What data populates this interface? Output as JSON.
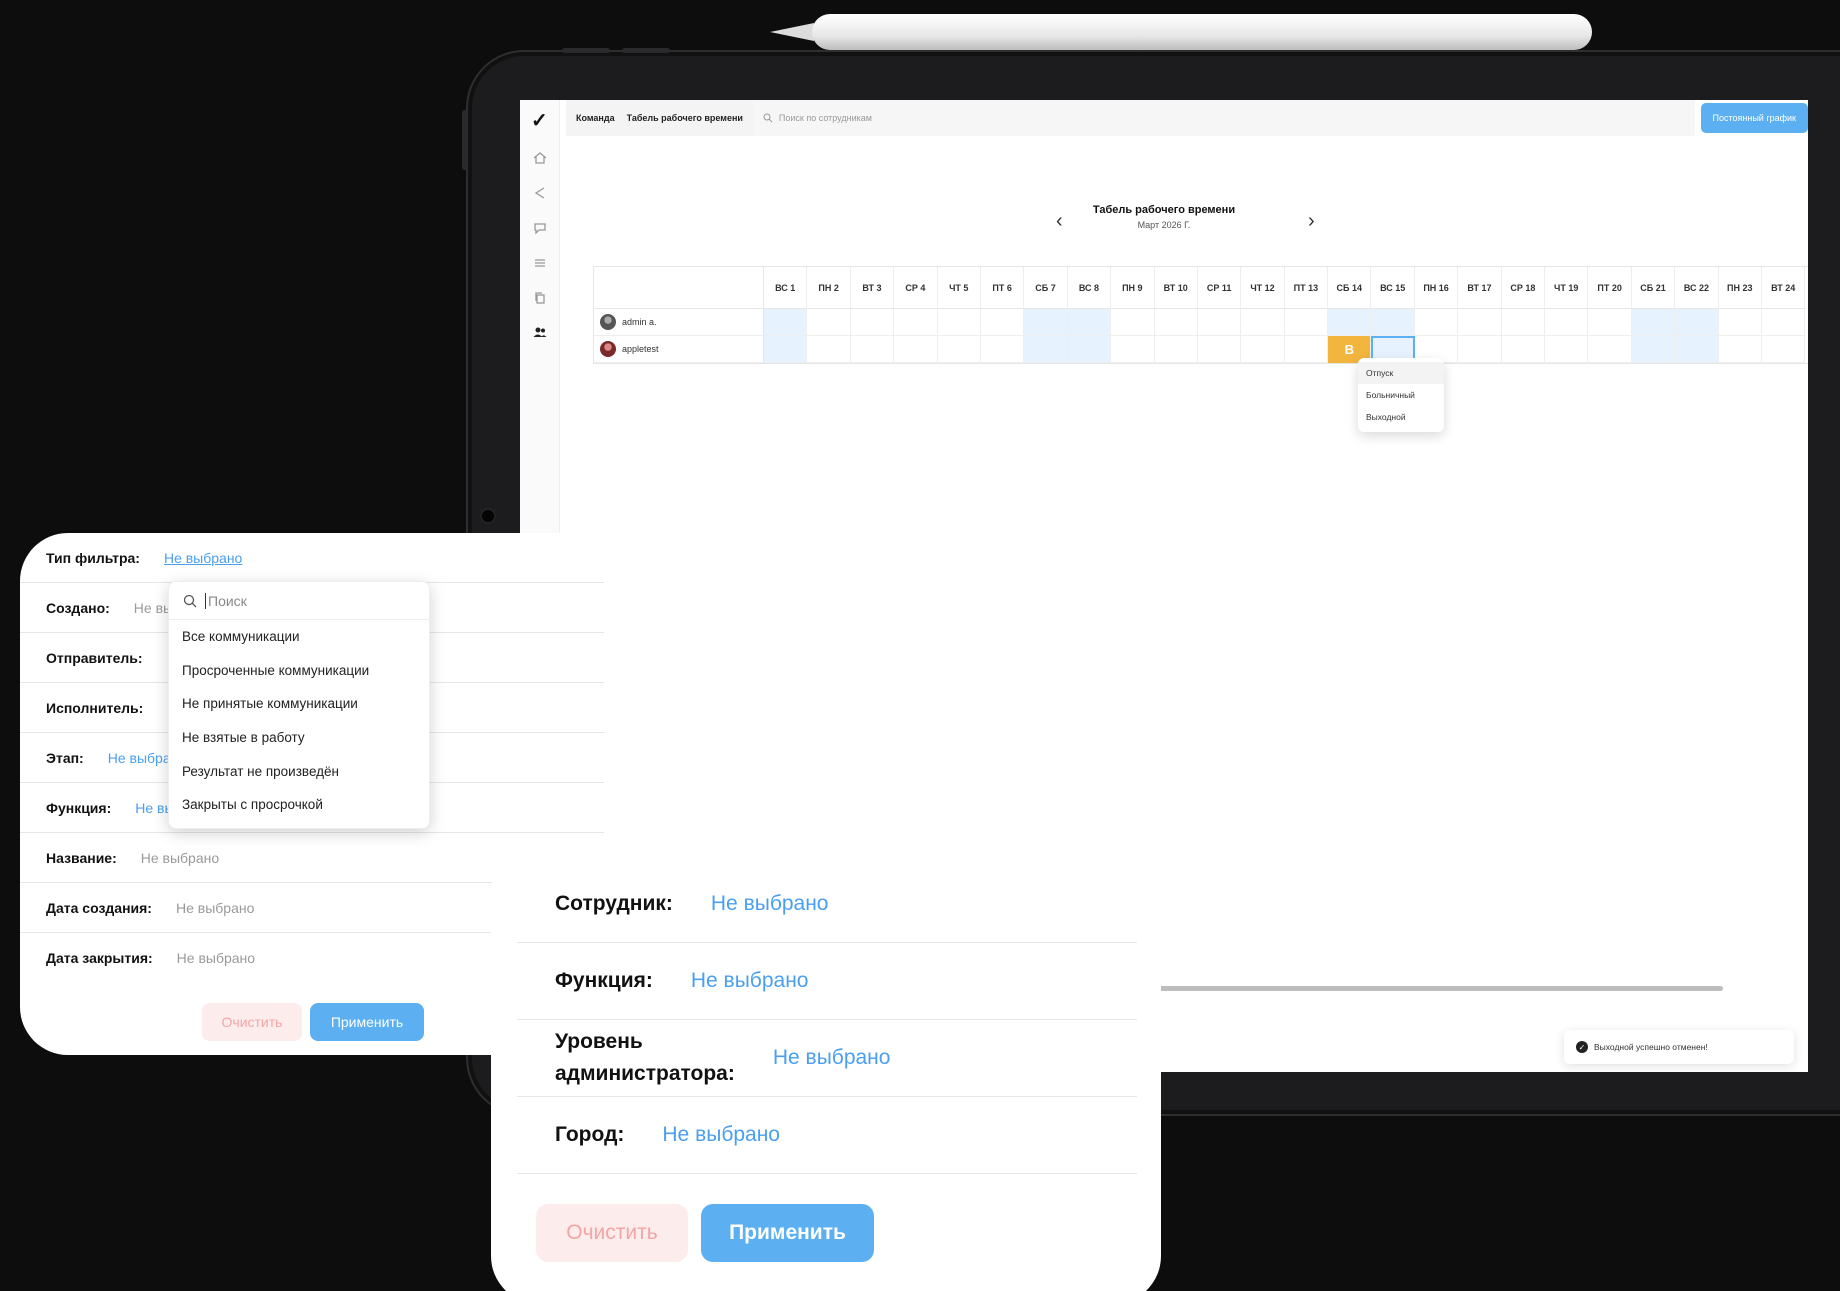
{
  "app": {
    "breadcrumbs": [
      "Команда",
      "Табель рабочего времени"
    ],
    "search_placeholder": "Поиск по сотрудникам",
    "schedule_button": "Постоянный график"
  },
  "timesheet": {
    "title": "Табель рабочего времени",
    "subtitle": "Март 2026 Г.",
    "days": [
      "ВС 1",
      "ПН 2",
      "ВТ 3",
      "СР 4",
      "ЧТ 5",
      "ПТ 6",
      "СБ 7",
      "ВС 8",
      "ПН 9",
      "ВТ 10",
      "СР 11",
      "ЧТ 12",
      "ПТ 13",
      "СБ 14",
      "ВС 15",
      "ПН 16",
      "ВТ 17",
      "СР 18",
      "ЧТ 19",
      "ПТ 20",
      "СБ 21",
      "ВС 22",
      "ПН 23",
      "ВТ 24"
    ],
    "rows": [
      {
        "name": "admin a."
      },
      {
        "name": "appletest",
        "marked_day": "СБ 14",
        "mark": "В"
      }
    ],
    "context_menu": [
      "Отпуск",
      "Больничный",
      "Выходной"
    ],
    "toast": "Выходной успешно отменен!"
  },
  "filter1": {
    "rows": [
      {
        "label": "Тип фильтра:",
        "value": "Не выбрано"
      },
      {
        "label": "Создано:",
        "value": "Не выбрано"
      },
      {
        "label": "Отправитель:",
        "value": ""
      },
      {
        "label": "Исполнитель:",
        "value": ""
      },
      {
        "label": "Этап:",
        "value": "Не выбрано"
      },
      {
        "label": "Функция:",
        "value": "Не выбрано"
      },
      {
        "label": "Название:",
        "value": "Не выбрано"
      },
      {
        "label": "Дата создания:",
        "value": "Не выбрано"
      },
      {
        "label": "Дата закрытия:",
        "value": "Не выбрано"
      }
    ],
    "dropdown": {
      "placeholder": "Поиск",
      "items": [
        "Все коммуникации",
        "Просроченные коммуникации",
        "Не принятые коммуникации",
        "Не взятые в работу",
        "Результат не произведён",
        "Закрыты с просрочкой"
      ]
    },
    "clear": "Очистить",
    "apply": "Применить"
  },
  "filter2": {
    "rows": [
      {
        "label": "Сотрудник:",
        "value": "Не выбрано"
      },
      {
        "label": "Функция:",
        "value": "Не выбрано"
      },
      {
        "label_line1": "Уровень",
        "label_line2": "администратора:",
        "value": "Не выбрано"
      },
      {
        "label": "Город:",
        "value": "Не выбрано"
      }
    ],
    "clear": "Очистить",
    "apply": "Применить"
  },
  "colors": {
    "accent": "#5cb0f2",
    "link": "#4a9ff0",
    "weekend_fill": "#e6f2fd",
    "mark": "#f2b63e",
    "clear_bg": "#fdecec",
    "clear_text": "#f2a5a5"
  }
}
